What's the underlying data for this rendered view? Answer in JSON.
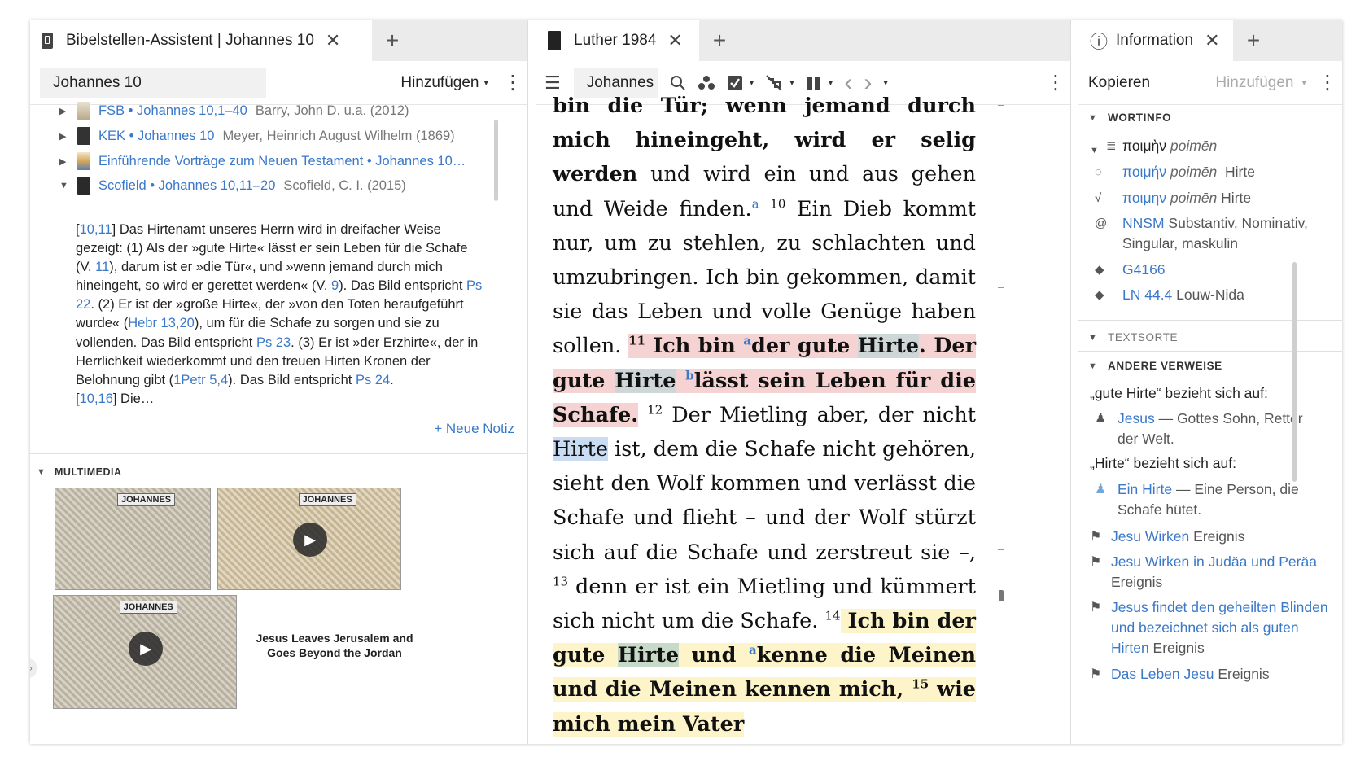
{
  "panel1": {
    "tab": {
      "title": "Bibelstellen-Assistent | Johannes 10",
      "close": "✕",
      "add": "+"
    },
    "toolbar": {
      "reference": "Johannes 10",
      "add_label": "Hinzufügen",
      "caret": "▾",
      "more": "⋮"
    },
    "resources": [
      {
        "link": "FSB • Johannes 10,1–40",
        "meta": "Barry, John D. u.a. (2012)",
        "expanded": false
      },
      {
        "link": "KEK • Johannes 10",
        "meta": "Meyer, Heinrich August Wilhelm (1869)",
        "expanded": false
      },
      {
        "link": "Einführende Vorträge zum Neuen Testament • Johannes 10…",
        "meta": "",
        "expanded": false
      },
      {
        "link": "Scofield • Johannes 10,11–20",
        "meta": "Scofield, C. I. (2015)",
        "expanded": true
      }
    ],
    "note": {
      "r1": "10,11",
      "t1": "] Das Hirtenamt unseres Herrn wird in dreifacher Weise gezeigt: (1) Als der »gute Hirte« lässt er sein Leben für die Schafe (V. ",
      "r2": "11",
      "t2": "), darum ist er »die Tür«, und »wenn jemand durch mich hineingeht, so wird er gerettet werden« (V. ",
      "r3": "9",
      "t3": "). Das Bild entspricht ",
      "r4": "Ps 22",
      "t4": ". (2) Er ist der »große Hirte«, der »von den Toten heraufgeführt wurde« (",
      "r5": "Hebr 13,20",
      "t5": "), um für die Schafe zu sorgen und sie zu vollenden. Das Bild entspricht ",
      "r6": "Ps 23",
      "t6": ". (3) Er ist »der Erzhirte«, der in Herrlichkeit wiederkommt und den treuen Hirten Kronen der Belohnung gibt (",
      "r7": "1Petr 5,4",
      "t7": "). Das Bild entspricht ",
      "r8": "Ps 24",
      "t8": ".",
      "r9": "10,16",
      "t9": "] Die…"
    },
    "new_note": "+ Neue Notiz",
    "multimedia": {
      "header": "MULTIMEDIA",
      "thumb_label": "JOHANNES",
      "play": "▶",
      "caption": "Jesus Leaves Jerusalem and Goes Beyond the Jordan"
    }
  },
  "panel2": {
    "tab": {
      "title": "Luther 1984",
      "close": "✕",
      "add": "+"
    },
    "toolbar": {
      "reference": "Johannes",
      "menu": "☰",
      "search": "⚲",
      "more": "⋮",
      "back": "‹",
      "forward": "›"
    },
    "text": {
      "l1": "bin die Tür; wenn jemand durch mich hineingeht, wird er selig werden",
      "l1b": " und wird ein und aus gehen und Weide finden.",
      "fn_a": "a",
      "v10": "10",
      "t10": " Ein Dieb kommt nur, um zu stehlen, zu schlachten und umzubringen. Ich bin gekommen, damit sie das Leben und volle Genüge haben sollen.",
      "v11": "11",
      "t11a": " Ich bin ",
      "fn_a2": "a",
      "t11b": "der gute ",
      "hirte": "Hirte",
      "t11c": ". Der gute ",
      "fn_b": "b",
      "t11d": "lässt sein Leben für die Schafe.",
      "v12": "12",
      "t12a": " Der Mietling aber, der nicht ",
      "t12b": " ist, dem die Schafe nicht gehören, sieht den Wolf kommen und verlässt die Schafe und flieht – und der Wolf stürzt sich auf die Schafe und zerstreut sie –,",
      "v13": "13",
      "t13": " denn er ist ein Mietling und kümmert sich nicht um die Schafe.",
      "v14": "14",
      "t14a": " Ich bin der gute ",
      "t14b": " und ",
      "fn_a3": "a",
      "t14c": "kenne die Meinen und die Meinen kennen mich,",
      "v15": "15",
      "t15": " wie mich mein Vater"
    }
  },
  "panel3": {
    "tab": {
      "title": "Information",
      "close": "✕",
      "add": "+",
      "icon": "ⓘ"
    },
    "toolbar": {
      "copy": "Kopieren",
      "add_label": "Hinzufügen",
      "caret": "▾",
      "more": "⋮"
    },
    "wortinfo": {
      "header": "WORTINFO",
      "lemma_greek": "ποιμὴν",
      "lemma_translit": "poimēn",
      "rows": [
        {
          "icon": "◌",
          "link": "ποιμήν",
          "translit": "poimēn",
          "gloss": "Hirte"
        },
        {
          "icon": "√",
          "link": "ποιμην",
          "translit": "poimēn",
          "gloss": "Hirte"
        },
        {
          "icon": "@",
          "link": "NNSM",
          "gloss": "Substantiv, Nominativ, Singular, maskulin"
        },
        {
          "icon": "◆",
          "link": "G4166",
          "gloss": ""
        },
        {
          "icon": "◆",
          "link": "LN 44.4",
          "gloss": "Louw-Nida"
        }
      ]
    },
    "textsorte": {
      "header": "TEXTSORTE"
    },
    "verweise": {
      "header": "ANDERE VERWEISE",
      "ref1_label": "„gute Hirte“ bezieht sich auf:",
      "ref1_link": "Jesus",
      "ref1_desc": " — Gottes Sohn, Retter der Welt.",
      "ref2_label": "„Hirte“ bezieht sich auf:",
      "ref2_link": "Ein Hirte",
      "ref2_desc": " — Eine Person, die Schafe hütet.",
      "events": [
        {
          "link": "Jesu Wirken",
          "type": " Ereignis"
        },
        {
          "link": "Jesu Wirken in Judäa und Peräa",
          "type": " Ereignis"
        },
        {
          "link": "Jesus findet den geheilten Blinden und bezeichnet sich als guten Hirten",
          "type": " Ereignis"
        },
        {
          "link": "Das Leben Jesu",
          "type": " Ereignis"
        }
      ]
    }
  }
}
